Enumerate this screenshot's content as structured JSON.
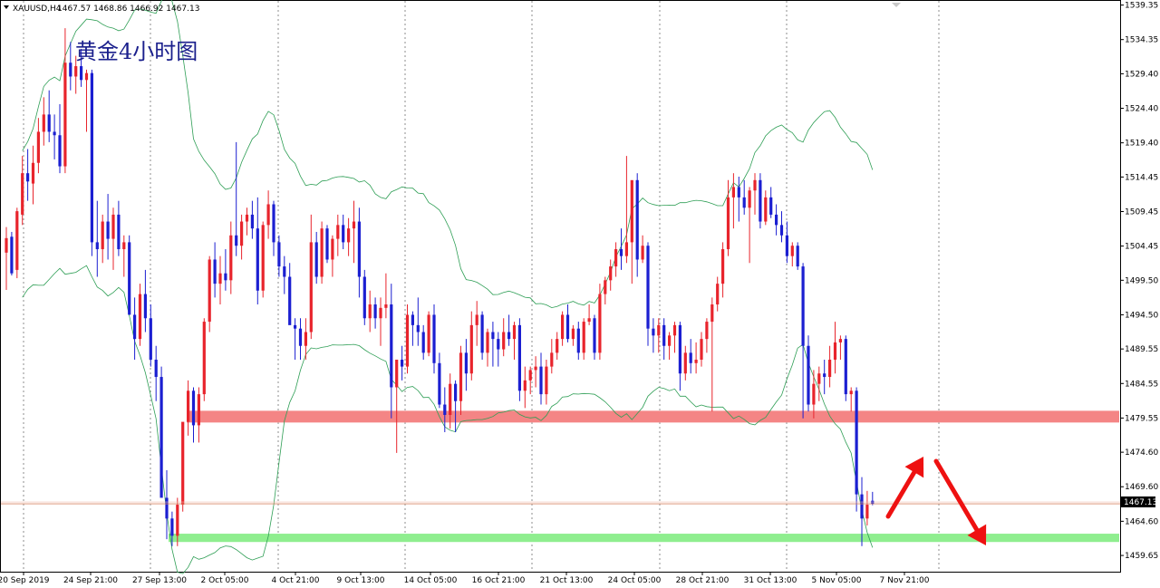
{
  "header": {
    "symbol_timeframe": "XAUUSD,H4",
    "ohlc": "1467.57 1468.86 1466.92 1467.13",
    "menu_icon": "triangle-down-icon"
  },
  "annotation_title": "黄金4小时图",
  "price_label": "1467.13",
  "colors": {
    "bull_candle": "#e8242c",
    "bear_candle": "#1b1fd1",
    "bollinger": "#2e9e55",
    "resistance_zone": "#f48585",
    "support_zone": "#8fee8f",
    "price_line": "#d98a68",
    "arrows": "#ee1111"
  },
  "chart_data": {
    "type": "candlestick",
    "title": "黄金4小时图",
    "symbol": "XAUUSD",
    "timeframe": "H4",
    "ylim": [
      1457.3,
      1539.95
    ],
    "y_ticks": [
      "1539.35",
      "1534.35",
      "1529.40",
      "1524.40",
      "1519.40",
      "1514.45",
      "1509.45",
      "1504.45",
      "1499.50",
      "1494.50",
      "1489.55",
      "1484.55",
      "1479.55",
      "1474.60",
      "1469.60",
      "1464.60",
      "1459.65"
    ],
    "x_ticks": [
      "20 Sep 2019",
      "24 Sep 21:00",
      "27 Sep 13:00",
      "2 Oct 05:00",
      "4 Oct 21:00",
      "9 Oct 13:00",
      "14 Oct 05:00",
      "16 Oct 21:00",
      "21 Oct 13:00",
      "24 Oct 05:00",
      "28 Oct 21:00",
      "31 Oct 13:00",
      "5 Nov 05:00",
      "7 Nov 21:00"
    ],
    "grid": "vertical dotted at date ticks",
    "last_price": 1467.13,
    "resistance_zone": [
      1478.9,
      1480.6
    ],
    "support_zone": [
      1461.6,
      1462.8
    ],
    "candles": [
      {
        "o": 1503.5,
        "h": 1507.2,
        "l": 1498.1,
        "c": 1505.6
      },
      {
        "o": 1505.8,
        "h": 1506.5,
        "l": 1500.2,
        "c": 1500.5
      },
      {
        "o": 1501.0,
        "h": 1510.0,
        "l": 1499.8,
        "c": 1509.5
      },
      {
        "o": 1509.0,
        "h": 1517.5,
        "l": 1507.5,
        "c": 1515.0
      },
      {
        "o": 1515.0,
        "h": 1518.5,
        "l": 1511.0,
        "c": 1513.8
      },
      {
        "o": 1513.5,
        "h": 1519.0,
        "l": 1510.5,
        "c": 1516.5
      },
      {
        "o": 1516.5,
        "h": 1523.0,
        "l": 1515.0,
        "c": 1521.0
      },
      {
        "o": 1521.0,
        "h": 1526.0,
        "l": 1519.0,
        "c": 1523.5
      },
      {
        "o": 1523.5,
        "h": 1527.0,
        "l": 1519.5,
        "c": 1521.0
      },
      {
        "o": 1521.0,
        "h": 1523.5,
        "l": 1517.0,
        "c": 1520.5
      },
      {
        "o": 1520.5,
        "h": 1525.0,
        "l": 1515.0,
        "c": 1516.0
      },
      {
        "o": 1516.0,
        "h": 1536.0,
        "l": 1515.0,
        "c": 1531.0
      },
      {
        "o": 1531.0,
        "h": 1534.0,
        "l": 1527.0,
        "c": 1529.0
      },
      {
        "o": 1529.0,
        "h": 1532.0,
        "l": 1526.5,
        "c": 1530.5
      },
      {
        "o": 1530.5,
        "h": 1533.0,
        "l": 1527.5,
        "c": 1528.5
      },
      {
        "o": 1528.5,
        "h": 1530.0,
        "l": 1521.0,
        "c": 1529.5
      },
      {
        "o": 1529.5,
        "h": 1530.0,
        "l": 1503.0,
        "c": 1505.0
      },
      {
        "o": 1505.0,
        "h": 1511.0,
        "l": 1500.0,
        "c": 1504.0
      },
      {
        "o": 1504.0,
        "h": 1509.0,
        "l": 1502.0,
        "c": 1508.0
      },
      {
        "o": 1508.0,
        "h": 1512.0,
        "l": 1502.5,
        "c": 1505.5
      },
      {
        "o": 1505.5,
        "h": 1510.0,
        "l": 1501.0,
        "c": 1509.0
      },
      {
        "o": 1509.0,
        "h": 1511.0,
        "l": 1503.0,
        "c": 1504.0
      },
      {
        "o": 1504.0,
        "h": 1506.0,
        "l": 1500.0,
        "c": 1505.0
      },
      {
        "o": 1505.0,
        "h": 1506.0,
        "l": 1496.0,
        "c": 1494.5
      },
      {
        "o": 1494.5,
        "h": 1497.0,
        "l": 1488.0,
        "c": 1491.0
      },
      {
        "o": 1491.0,
        "h": 1499.0,
        "l": 1490.0,
        "c": 1497.5
      },
      {
        "o": 1497.5,
        "h": 1501.0,
        "l": 1492.0,
        "c": 1494.0
      },
      {
        "o": 1494.0,
        "h": 1496.0,
        "l": 1487.0,
        "c": 1488.0
      },
      {
        "o": 1488.0,
        "h": 1490.0,
        "l": 1482.0,
        "c": 1485.5
      },
      {
        "o": 1485.5,
        "h": 1487.0,
        "l": 1475.0,
        "c": 1468.0
      },
      {
        "o": 1468.0,
        "h": 1472.0,
        "l": 1462.0,
        "c": 1465.0
      },
      {
        "o": 1465.0,
        "h": 1466.0,
        "l": 1461.0,
        "c": 1462.5
      },
      {
        "o": 1462.5,
        "h": 1468.0,
        "l": 1461.0,
        "c": 1467.0
      },
      {
        "o": 1467.0,
        "h": 1474.0,
        "l": 1466.0,
        "c": 1479.0
      },
      {
        "o": 1479.0,
        "h": 1485.0,
        "l": 1477.0,
        "c": 1483.5
      },
      {
        "o": 1483.5,
        "h": 1484.0,
        "l": 1476.0,
        "c": 1478.5
      },
      {
        "o": 1478.5,
        "h": 1484.0,
        "l": 1476.0,
        "c": 1483.0
      },
      {
        "o": 1483.0,
        "h": 1494.0,
        "l": 1482.0,
        "c": 1493.5
      },
      {
        "o": 1493.5,
        "h": 1503.0,
        "l": 1492.0,
        "c": 1502.5
      },
      {
        "o": 1502.5,
        "h": 1505.0,
        "l": 1497.0,
        "c": 1499.0
      },
      {
        "o": 1499.0,
        "h": 1503.0,
        "l": 1496.0,
        "c": 1500.5
      },
      {
        "o": 1500.5,
        "h": 1504.0,
        "l": 1498.0,
        "c": 1499.5
      },
      {
        "o": 1499.5,
        "h": 1508.0,
        "l": 1497.5,
        "c": 1506.0
      },
      {
        "o": 1506.0,
        "h": 1519.5,
        "l": 1503.0,
        "c": 1504.5
      },
      {
        "o": 1504.5,
        "h": 1509.0,
        "l": 1502.5,
        "c": 1508.0
      },
      {
        "o": 1508.0,
        "h": 1510.0,
        "l": 1506.0,
        "c": 1509.0
      },
      {
        "o": 1509.0,
        "h": 1511.0,
        "l": 1505.5,
        "c": 1507.0
      },
      {
        "o": 1507.0,
        "h": 1511.5,
        "l": 1496.0,
        "c": 1498.0
      },
      {
        "o": 1498.0,
        "h": 1508.0,
        "l": 1497.0,
        "c": 1507.5
      },
      {
        "o": 1507.5,
        "h": 1512.5,
        "l": 1505.5,
        "c": 1510.5
      },
      {
        "o": 1510.5,
        "h": 1511.0,
        "l": 1503.0,
        "c": 1505.0
      },
      {
        "o": 1505.0,
        "h": 1506.0,
        "l": 1500.0,
        "c": 1501.5
      },
      {
        "o": 1501.5,
        "h": 1503.0,
        "l": 1497.5,
        "c": 1500.0
      },
      {
        "o": 1500.0,
        "h": 1502.0,
        "l": 1497.0,
        "c": 1493.0
      },
      {
        "o": 1493.0,
        "h": 1494.0,
        "l": 1488.0,
        "c": 1492.5
      },
      {
        "o": 1492.5,
        "h": 1494.0,
        "l": 1488.0,
        "c": 1490.0
      },
      {
        "o": 1490.0,
        "h": 1494.0,
        "l": 1488.0,
        "c": 1492.0
      },
      {
        "o": 1492.0,
        "h": 1509.0,
        "l": 1491.0,
        "c": 1505.0
      },
      {
        "o": 1505.0,
        "h": 1506.5,
        "l": 1499.0,
        "c": 1500.0
      },
      {
        "o": 1500.0,
        "h": 1508.0,
        "l": 1499.0,
        "c": 1507.0
      },
      {
        "o": 1507.0,
        "h": 1507.5,
        "l": 1502.0,
        "c": 1502.5
      },
      {
        "o": 1502.5,
        "h": 1506.0,
        "l": 1500.0,
        "c": 1505.5
      },
      {
        "o": 1505.5,
        "h": 1509.0,
        "l": 1503.0,
        "c": 1507.5
      },
      {
        "o": 1507.5,
        "h": 1509.0,
        "l": 1504.0,
        "c": 1505.0
      },
      {
        "o": 1505.0,
        "h": 1508.5,
        "l": 1503.0,
        "c": 1507.0
      },
      {
        "o": 1507.0,
        "h": 1511.0,
        "l": 1502.0,
        "c": 1508.0
      },
      {
        "o": 1508.0,
        "h": 1510.0,
        "l": 1497.0,
        "c": 1500.0
      },
      {
        "o": 1500.0,
        "h": 1501.0,
        "l": 1493.0,
        "c": 1494.0
      },
      {
        "o": 1494.0,
        "h": 1498.0,
        "l": 1492.0,
        "c": 1496.0
      },
      {
        "o": 1496.0,
        "h": 1497.0,
        "l": 1492.5,
        "c": 1494.0
      },
      {
        "o": 1494.0,
        "h": 1497.0,
        "l": 1490.0,
        "c": 1495.5
      },
      {
        "o": 1495.5,
        "h": 1500.5,
        "l": 1494.0,
        "c": 1496.0
      },
      {
        "o": 1496.0,
        "h": 1499.0,
        "l": 1479.5,
        "c": 1484.0
      },
      {
        "o": 1484.0,
        "h": 1486.0,
        "l": 1474.5,
        "c": 1488.0
      },
      {
        "o": 1488.0,
        "h": 1490.0,
        "l": 1485.0,
        "c": 1487.0
      },
      {
        "o": 1487.0,
        "h": 1496.0,
        "l": 1486.0,
        "c": 1494.5
      },
      {
        "o": 1494.5,
        "h": 1495.0,
        "l": 1490.0,
        "c": 1493.0
      },
      {
        "o": 1493.0,
        "h": 1497.0,
        "l": 1490.0,
        "c": 1492.0
      },
      {
        "o": 1492.0,
        "h": 1493.0,
        "l": 1488.0,
        "c": 1489.0
      },
      {
        "o": 1489.0,
        "h": 1495.0,
        "l": 1488.5,
        "c": 1494.5
      },
      {
        "o": 1494.5,
        "h": 1496.0,
        "l": 1486.0,
        "c": 1487.5
      },
      {
        "o": 1487.5,
        "h": 1489.0,
        "l": 1481.0,
        "c": 1481.5
      },
      {
        "o": 1481.5,
        "h": 1484.0,
        "l": 1477.5,
        "c": 1480.0
      },
      {
        "o": 1480.0,
        "h": 1486.0,
        "l": 1478.0,
        "c": 1484.5
      },
      {
        "o": 1484.5,
        "h": 1485.0,
        "l": 1477.5,
        "c": 1482.0
      },
      {
        "o": 1482.0,
        "h": 1490.0,
        "l": 1480.0,
        "c": 1489.0
      },
      {
        "o": 1489.0,
        "h": 1491.0,
        "l": 1483.5,
        "c": 1486.0
      },
      {
        "o": 1486.0,
        "h": 1495.0,
        "l": 1485.0,
        "c": 1493.0
      },
      {
        "o": 1493.0,
        "h": 1496.5,
        "l": 1490.0,
        "c": 1494.5
      },
      {
        "o": 1494.5,
        "h": 1495.0,
        "l": 1488.0,
        "c": 1489.0
      },
      {
        "o": 1489.0,
        "h": 1492.5,
        "l": 1487.0,
        "c": 1492.0
      },
      {
        "o": 1492.0,
        "h": 1493.5,
        "l": 1487.0,
        "c": 1491.0
      },
      {
        "o": 1491.0,
        "h": 1492.0,
        "l": 1487.0,
        "c": 1489.5
      },
      {
        "o": 1489.5,
        "h": 1494.0,
        "l": 1488.5,
        "c": 1492.0
      },
      {
        "o": 1492.0,
        "h": 1494.5,
        "l": 1490.0,
        "c": 1491.0
      },
      {
        "o": 1491.0,
        "h": 1493.5,
        "l": 1488.0,
        "c": 1493.0
      },
      {
        "o": 1493.0,
        "h": 1494.0,
        "l": 1482.0,
        "c": 1483.5
      },
      {
        "o": 1483.5,
        "h": 1487.0,
        "l": 1481.0,
        "c": 1485.0
      },
      {
        "o": 1485.0,
        "h": 1487.0,
        "l": 1483.0,
        "c": 1486.5
      },
      {
        "o": 1486.5,
        "h": 1488.5,
        "l": 1484.0,
        "c": 1487.0
      },
      {
        "o": 1487.0,
        "h": 1489.0,
        "l": 1481.5,
        "c": 1483.0
      },
      {
        "o": 1483.0,
        "h": 1488.0,
        "l": 1481.5,
        "c": 1487.0
      },
      {
        "o": 1487.0,
        "h": 1491.0,
        "l": 1486.0,
        "c": 1489.0
      },
      {
        "o": 1489.0,
        "h": 1492.0,
        "l": 1488.0,
        "c": 1491.0
      },
      {
        "o": 1491.0,
        "h": 1495.0,
        "l": 1490.0,
        "c": 1494.5
      },
      {
        "o": 1494.5,
        "h": 1496.0,
        "l": 1490.5,
        "c": 1491.0
      },
      {
        "o": 1491.0,
        "h": 1493.0,
        "l": 1490.0,
        "c": 1492.5
      },
      {
        "o": 1492.5,
        "h": 1493.5,
        "l": 1488.0,
        "c": 1489.0
      },
      {
        "o": 1489.0,
        "h": 1494.0,
        "l": 1488.0,
        "c": 1493.5
      },
      {
        "o": 1493.5,
        "h": 1496.0,
        "l": 1493.0,
        "c": 1494.0
      },
      {
        "o": 1494.0,
        "h": 1494.5,
        "l": 1488.0,
        "c": 1489.0
      },
      {
        "o": 1489.0,
        "h": 1499.0,
        "l": 1488.0,
        "c": 1497.5
      },
      {
        "o": 1497.5,
        "h": 1500.0,
        "l": 1496.0,
        "c": 1499.5
      },
      {
        "o": 1499.5,
        "h": 1502.5,
        "l": 1498.0,
        "c": 1501.5
      },
      {
        "o": 1501.5,
        "h": 1505.0,
        "l": 1500.0,
        "c": 1504.0
      },
      {
        "o": 1504.0,
        "h": 1507.0,
        "l": 1501.0,
        "c": 1503.0
      },
      {
        "o": 1503.0,
        "h": 1517.5,
        "l": 1502.0,
        "c": 1505.0
      },
      {
        "o": 1505.0,
        "h": 1513.5,
        "l": 1499.0,
        "c": 1514.0
      },
      {
        "o": 1514.0,
        "h": 1515.0,
        "l": 1500.0,
        "c": 1502.5
      },
      {
        "o": 1502.5,
        "h": 1506.0,
        "l": 1502.0,
        "c": 1504.5
      },
      {
        "o": 1504.5,
        "h": 1505.0,
        "l": 1490.0,
        "c": 1492.5
      },
      {
        "o": 1492.5,
        "h": 1494.0,
        "l": 1489.0,
        "c": 1491.5
      },
      {
        "o": 1491.5,
        "h": 1494.0,
        "l": 1489.0,
        "c": 1493.0
      },
      {
        "o": 1493.0,
        "h": 1494.0,
        "l": 1488.0,
        "c": 1490.0
      },
      {
        "o": 1490.0,
        "h": 1492.0,
        "l": 1488.0,
        "c": 1491.5
      },
      {
        "o": 1491.5,
        "h": 1493.5,
        "l": 1489.0,
        "c": 1493.0
      },
      {
        "o": 1493.0,
        "h": 1493.5,
        "l": 1483.5,
        "c": 1486.0
      },
      {
        "o": 1486.0,
        "h": 1490.0,
        "l": 1485.0,
        "c": 1489.0
      },
      {
        "o": 1489.0,
        "h": 1491.0,
        "l": 1486.0,
        "c": 1487.5
      },
      {
        "o": 1487.5,
        "h": 1490.5,
        "l": 1486.0,
        "c": 1488.0
      },
      {
        "o": 1488.0,
        "h": 1492.0,
        "l": 1487.0,
        "c": 1491.0
      },
      {
        "o": 1491.0,
        "h": 1494.0,
        "l": 1489.0,
        "c": 1493.5
      },
      {
        "o": 1493.5,
        "h": 1497.0,
        "l": 1480.5,
        "c": 1496.0
      },
      {
        "o": 1496.0,
        "h": 1500.0,
        "l": 1495.0,
        "c": 1499.0
      },
      {
        "o": 1499.0,
        "h": 1505.0,
        "l": 1497.0,
        "c": 1504.0
      },
      {
        "o": 1504.0,
        "h": 1514.0,
        "l": 1503.0,
        "c": 1511.5
      },
      {
        "o": 1511.5,
        "h": 1515.0,
        "l": 1507.0,
        "c": 1513.0
      },
      {
        "o": 1513.0,
        "h": 1514.5,
        "l": 1508.0,
        "c": 1511.5
      },
      {
        "o": 1511.5,
        "h": 1514.0,
        "l": 1509.0,
        "c": 1510.0
      },
      {
        "o": 1510.0,
        "h": 1513.0,
        "l": 1502.0,
        "c": 1512.5
      },
      {
        "o": 1512.5,
        "h": 1515.0,
        "l": 1509.0,
        "c": 1514.0
      },
      {
        "o": 1514.0,
        "h": 1515.0,
        "l": 1507.0,
        "c": 1508.0
      },
      {
        "o": 1508.0,
        "h": 1512.5,
        "l": 1507.5,
        "c": 1511.5
      },
      {
        "o": 1511.5,
        "h": 1513.0,
        "l": 1508.5,
        "c": 1509.0
      },
      {
        "o": 1509.0,
        "h": 1510.5,
        "l": 1506.0,
        "c": 1507.5
      },
      {
        "o": 1507.5,
        "h": 1509.5,
        "l": 1505.0,
        "c": 1506.0
      },
      {
        "o": 1506.0,
        "h": 1508.0,
        "l": 1502.0,
        "c": 1503.0
      },
      {
        "o": 1503.0,
        "h": 1505.0,
        "l": 1501.5,
        "c": 1504.5
      },
      {
        "o": 1504.5,
        "h": 1505.0,
        "l": 1501.0,
        "c": 1501.5
      },
      {
        "o": 1501.5,
        "h": 1502.0,
        "l": 1479.5,
        "c": 1490.0
      },
      {
        "o": 1490.0,
        "h": 1491.5,
        "l": 1480.5,
        "c": 1481.5
      },
      {
        "o": 1481.5,
        "h": 1486.5,
        "l": 1479.5,
        "c": 1484.5
      },
      {
        "o": 1484.5,
        "h": 1487.0,
        "l": 1482.0,
        "c": 1486.0
      },
      {
        "o": 1486.0,
        "h": 1488.0,
        "l": 1483.0,
        "c": 1485.5
      },
      {
        "o": 1485.5,
        "h": 1490.0,
        "l": 1484.0,
        "c": 1488.0
      },
      {
        "o": 1488.0,
        "h": 1493.5,
        "l": 1486.0,
        "c": 1490.5
      },
      {
        "o": 1490.5,
        "h": 1491.5,
        "l": 1488.0,
        "c": 1491.0
      },
      {
        "o": 1491.0,
        "h": 1491.5,
        "l": 1482.0,
        "c": 1483.0
      },
      {
        "o": 1483.0,
        "h": 1484.0,
        "l": 1480.5,
        "c": 1483.5
      },
      {
        "o": 1483.5,
        "h": 1484.0,
        "l": 1466.0,
        "c": 1468.5
      },
      {
        "o": 1468.5,
        "h": 1471.0,
        "l": 1461.0,
        "c": 1465.0
      },
      {
        "o": 1465.0,
        "h": 1469.0,
        "l": 1464.0,
        "c": 1467.0
      },
      {
        "o": 1467.57,
        "h": 1468.86,
        "l": 1466.92,
        "c": 1467.13
      }
    ],
    "bollinger": {
      "period_note": "Bollinger Bands overlay",
      "upper_line_color": "#2e9e55"
    }
  }
}
